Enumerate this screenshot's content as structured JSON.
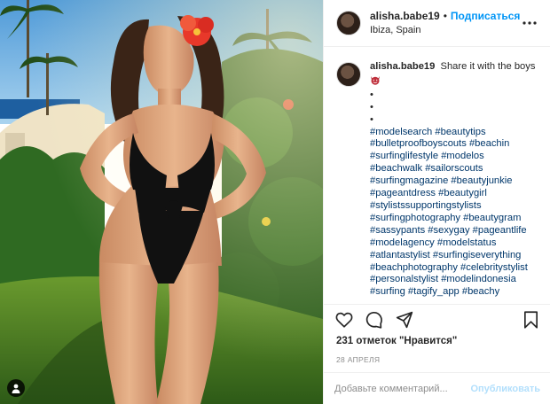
{
  "post": {
    "username": "alisha.babe19",
    "separator": "•",
    "follow_label": "Подписаться",
    "location": "Ibiza, Spain"
  },
  "caption": {
    "username": "alisha.babe19",
    "text": "Share it with the boys",
    "emoji": "devil-face-emoji",
    "dots": [
      "•",
      "•",
      "•"
    ],
    "hashtag_lines": [
      "#modelsearch #beautytips",
      "#bulletproofboyscouts #beachin",
      "#surfinglifestyle #modelos",
      "#beachwalk #sailorscouts",
      "#surfingmagazine #beautyjunkie",
      "#pageantdress #beautygirl",
      "#stylistssupportingstylists",
      "#surfingphotography #beautygram",
      "#sassypants #sexygay #pageantlife",
      "#modelagency #modelstatus",
      "#atlantastylist #surfingiseverything",
      "#beachphotography #celebritystylist",
      "#personalstylist #modelindonesia",
      "#surfing #tagify_app #beachy"
    ]
  },
  "engagement": {
    "likes": "231 отметок \"Нравится\"",
    "date": "28 АПРЕЛЯ"
  },
  "comment": {
    "placeholder": "Добавьте комментарий...",
    "publish_label": "Опубликовать"
  },
  "colors": {
    "accent": "#0095f6",
    "hashtag": "#00376b",
    "publish_disabled": "#b2dffc",
    "swimsuit": "#111111",
    "flower": "#e8382a"
  }
}
